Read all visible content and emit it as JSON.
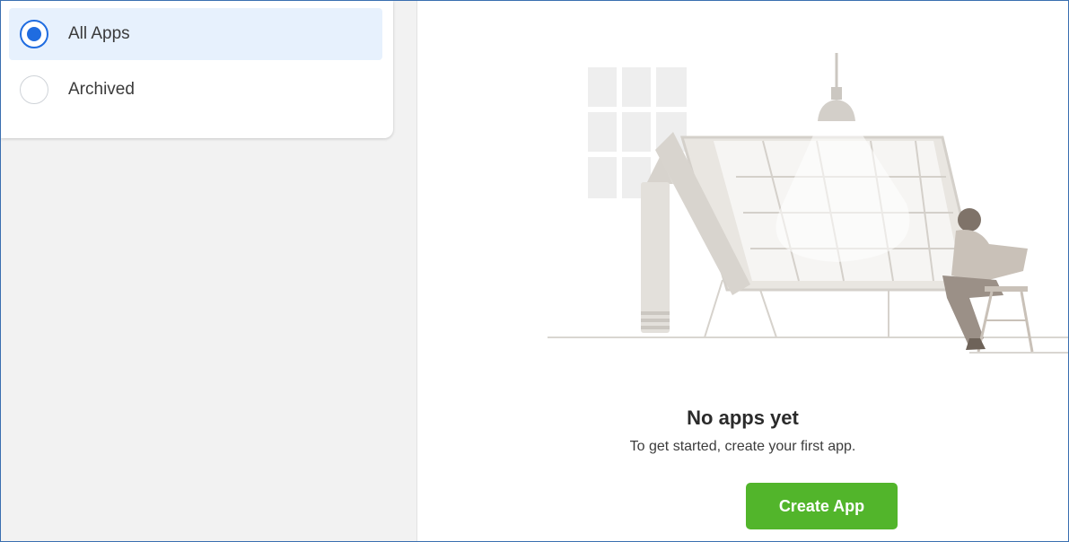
{
  "filters": {
    "items": [
      {
        "label": "All Apps",
        "selected": true
      },
      {
        "label": "Archived",
        "selected": false
      }
    ]
  },
  "empty_state": {
    "title": "No apps yet",
    "subtitle": "To get started, create your first app.",
    "illustration": "drafting-table-illustration"
  },
  "actions": {
    "create_label": "Create App"
  },
  "colors": {
    "accent_blue": "#1f6ce0",
    "selected_bg": "#e7f1fd",
    "button_green": "#52b52b",
    "sidebar_bg": "#f2f2f2"
  }
}
